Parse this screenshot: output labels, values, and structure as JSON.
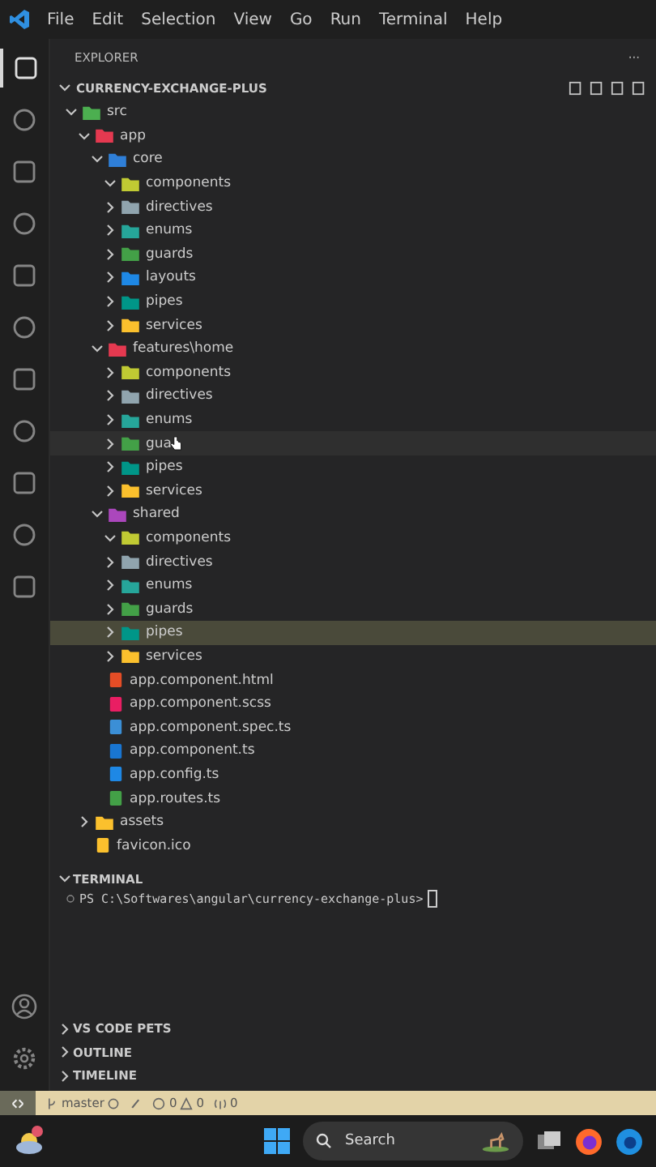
{
  "menu": [
    "File",
    "Edit",
    "Selection",
    "View",
    "Go",
    "Run",
    "Terminal",
    "Help"
  ],
  "explorer": {
    "title": "EXPLORER",
    "more": "···",
    "root": "CURRENCY-EXCHANGE-PLUS",
    "tree": [
      {
        "name": "src",
        "kind": "folder",
        "color": "#4caf50",
        "expanded": true,
        "selected": false,
        "hovered": false,
        "children": [
          {
            "name": "app",
            "kind": "folder",
            "color": "#e53950",
            "expanded": true,
            "selected": false,
            "hovered": false,
            "children": [
              {
                "name": "core",
                "kind": "folder",
                "color": "#2f7fd8",
                "expanded": true,
                "selected": false,
                "hovered": false,
                "children": [
                  {
                    "name": "components",
                    "kind": "folder",
                    "color": "#c0ca33",
                    "expanded": true,
                    "selected": false,
                    "hovered": false
                  },
                  {
                    "name": "directives",
                    "kind": "folder",
                    "color": "#90a4ae",
                    "expanded": false,
                    "selected": false,
                    "hovered": false
                  },
                  {
                    "name": "enums",
                    "kind": "folder",
                    "color": "#26a69a",
                    "expanded": false,
                    "selected": false,
                    "hovered": false
                  },
                  {
                    "name": "guards",
                    "kind": "folder",
                    "color": "#43a047",
                    "expanded": false,
                    "selected": false,
                    "hovered": false
                  },
                  {
                    "name": "layouts",
                    "kind": "folder",
                    "color": "#1e88e5",
                    "expanded": false,
                    "selected": false,
                    "hovered": false
                  },
                  {
                    "name": "pipes",
                    "kind": "folder",
                    "color": "#009688",
                    "expanded": false,
                    "selected": false,
                    "hovered": false
                  },
                  {
                    "name": "services",
                    "kind": "folder",
                    "color": "#fbc02d",
                    "expanded": false,
                    "selected": false,
                    "hovered": false
                  }
                ]
              },
              {
                "name": "features\\home",
                "kind": "folder",
                "color": "#e53950",
                "expanded": true,
                "selected": false,
                "hovered": false,
                "children": [
                  {
                    "name": "components",
                    "kind": "folder",
                    "color": "#c0ca33",
                    "expanded": false,
                    "selected": false,
                    "hovered": false
                  },
                  {
                    "name": "directives",
                    "kind": "folder",
                    "color": "#90a4ae",
                    "expanded": false,
                    "selected": false,
                    "hovered": false
                  },
                  {
                    "name": "enums",
                    "kind": "folder",
                    "color": "#26a69a",
                    "expanded": false,
                    "selected": false,
                    "hovered": false
                  },
                  {
                    "name": "gua",
                    "kind": "folder",
                    "color": "#43a047",
                    "expanded": false,
                    "selected": false,
                    "hovered": true
                  },
                  {
                    "name": "pipes",
                    "kind": "folder",
                    "color": "#009688",
                    "expanded": false,
                    "selected": false,
                    "hovered": false
                  },
                  {
                    "name": "services",
                    "kind": "folder",
                    "color": "#fbc02d",
                    "expanded": false,
                    "selected": false,
                    "hovered": false
                  }
                ]
              },
              {
                "name": "shared",
                "kind": "folder",
                "color": "#ab47bc",
                "expanded": true,
                "selected": false,
                "hovered": false,
                "children": [
                  {
                    "name": "components",
                    "kind": "folder",
                    "color": "#c0ca33",
                    "expanded": true,
                    "selected": false,
                    "hovered": false
                  },
                  {
                    "name": "directives",
                    "kind": "folder",
                    "color": "#90a4ae",
                    "expanded": false,
                    "selected": false,
                    "hovered": false
                  },
                  {
                    "name": "enums",
                    "kind": "folder",
                    "color": "#26a69a",
                    "expanded": false,
                    "selected": false,
                    "hovered": false
                  },
                  {
                    "name": "guards",
                    "kind": "folder",
                    "color": "#43a047",
                    "expanded": false,
                    "selected": false,
                    "hovered": false
                  },
                  {
                    "name": "pipes",
                    "kind": "folder",
                    "color": "#009688",
                    "expanded": false,
                    "selected": true,
                    "hovered": false
                  },
                  {
                    "name": "services",
                    "kind": "folder",
                    "color": "#fbc02d",
                    "expanded": false,
                    "selected": false,
                    "hovered": false
                  }
                ]
              },
              {
                "name": "app.component.html",
                "kind": "file",
                "color": "#e44d26",
                "selected": false,
                "hovered": false
              },
              {
                "name": "app.component.scss",
                "kind": "file",
                "color": "#e91e63",
                "selected": false,
                "hovered": false
              },
              {
                "name": "app.component.spec.ts",
                "kind": "file",
                "color": "#3b8fd6",
                "selected": false,
                "hovered": false
              },
              {
                "name": "app.component.ts",
                "kind": "file",
                "color": "#1976d2",
                "selected": false,
                "hovered": false
              },
              {
                "name": "app.config.ts",
                "kind": "file",
                "color": "#1e88e5",
                "selected": false,
                "hovered": false
              },
              {
                "name": "app.routes.ts",
                "kind": "file",
                "color": "#43a047",
                "selected": false,
                "hovered": false
              }
            ]
          },
          {
            "name": "assets",
            "kind": "folder",
            "color": "#fbc02d",
            "expanded": false,
            "selected": false,
            "hovered": false
          },
          {
            "name": "favicon.ico",
            "kind": "file",
            "color": "#fbc02d",
            "selected": false,
            "hovered": false
          }
        ]
      }
    ]
  },
  "terminal": {
    "title": "TERMINAL",
    "prompt": "PS C:\\Softwares\\angular\\currency-exchange-plus>"
  },
  "panels": [
    "VS CODE PETS",
    "OUTLINE",
    "TIMELINE"
  ],
  "status_bar": {
    "branch": "master",
    "errors": "0",
    "warnings": "0",
    "ports": "0"
  },
  "taskbar": {
    "search": "Search"
  }
}
